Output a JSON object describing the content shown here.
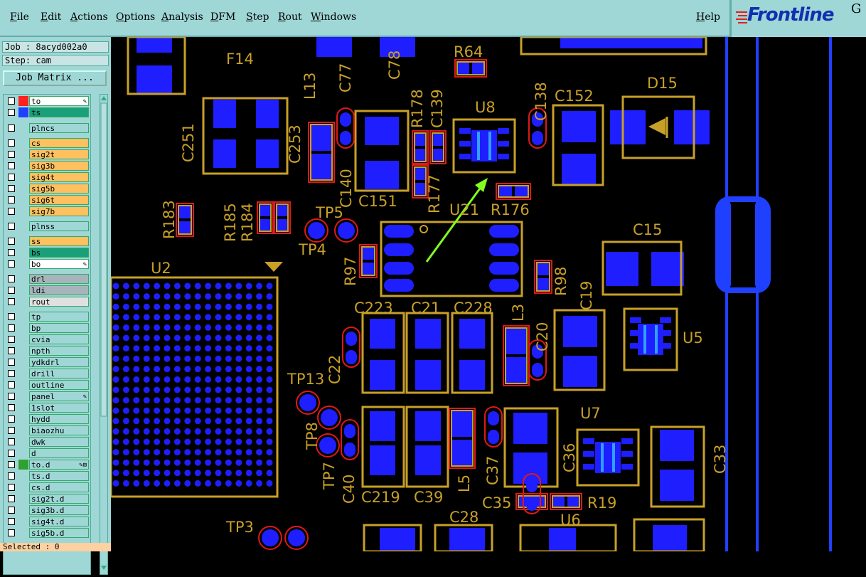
{
  "menu": {
    "items": [
      "File",
      "Edit",
      "Actions",
      "Options",
      "Analysis",
      "DFM",
      "Step",
      "Rout",
      "Windows"
    ],
    "help": "Help",
    "logo": "Frontline",
    "logo_suffix": "G"
  },
  "job": {
    "label": "Job : 8acyd002a0",
    "step": "Step: cam"
  },
  "job_matrix_button": "Job Matrix ...",
  "layers": [
    {
      "name": "to",
      "bg": "#ffffff",
      "swatch": "#ff2020",
      "icon": "✎"
    },
    {
      "name": "ts",
      "bg": "#1aa078",
      "swatch": "#2040ff",
      "icon": ""
    },
    {
      "name": "plncs",
      "bg": "#9fd6d6",
      "swatch": "",
      "icon": ""
    },
    {
      "name": "cs",
      "bg": "#ffc060",
      "swatch": "",
      "icon": ""
    },
    {
      "name": "sig2t",
      "bg": "#ffc060",
      "swatch": "",
      "icon": ""
    },
    {
      "name": "sig3b",
      "bg": "#ffc060",
      "swatch": "",
      "icon": ""
    },
    {
      "name": "sig4t",
      "bg": "#ffc060",
      "swatch": "",
      "icon": ""
    },
    {
      "name": "sig5b",
      "bg": "#ffc060",
      "swatch": "",
      "icon": ""
    },
    {
      "name": "sig6t",
      "bg": "#ffc060",
      "swatch": "",
      "icon": ""
    },
    {
      "name": "sig7b",
      "bg": "#ffc060",
      "swatch": "",
      "icon": ""
    },
    {
      "name": "plnss",
      "bg": "#9fd6d6",
      "swatch": "",
      "icon": ""
    },
    {
      "name": "ss",
      "bg": "#ffc060",
      "swatch": "",
      "icon": ""
    },
    {
      "name": "bs",
      "bg": "#1aa078",
      "swatch": "",
      "icon": ""
    },
    {
      "name": "bo",
      "bg": "#ffffff",
      "swatch": "",
      "icon": "✎"
    },
    {
      "name": "drl",
      "bg": "#a8b4bc",
      "swatch": "",
      "icon": ""
    },
    {
      "name": "ldi",
      "bg": "#a8b4bc",
      "swatch": "",
      "icon": ""
    },
    {
      "name": "rout",
      "bg": "#e0e0e0",
      "swatch": "",
      "icon": ""
    },
    {
      "name": "tp",
      "bg": "#9fd6d6",
      "swatch": "",
      "icon": ""
    },
    {
      "name": "bp",
      "bg": "#9fd6d6",
      "swatch": "",
      "icon": ""
    },
    {
      "name": "cvia",
      "bg": "#9fd6d6",
      "swatch": "",
      "icon": ""
    },
    {
      "name": "npth",
      "bg": "#9fd6d6",
      "swatch": "",
      "icon": ""
    },
    {
      "name": "ydkdrl",
      "bg": "#9fd6d6",
      "swatch": "",
      "icon": ""
    },
    {
      "name": "drill",
      "bg": "#9fd6d6",
      "swatch": "",
      "icon": ""
    },
    {
      "name": "outline",
      "bg": "#9fd6d6",
      "swatch": "",
      "icon": ""
    },
    {
      "name": "panel",
      "bg": "#9fd6d6",
      "swatch": "",
      "icon": "✎"
    },
    {
      "name": "1slot",
      "bg": "#9fd6d6",
      "swatch": "",
      "icon": ""
    },
    {
      "name": "hydd",
      "bg": "#9fd6d6",
      "swatch": "",
      "icon": ""
    },
    {
      "name": "biaozhu",
      "bg": "#9fd6d6",
      "swatch": "",
      "icon": ""
    },
    {
      "name": "dwk",
      "bg": "#9fd6d6",
      "swatch": "",
      "icon": ""
    },
    {
      "name": "d",
      "bg": "#9fd6d6",
      "swatch": "",
      "icon": ""
    },
    {
      "name": "to.d",
      "bg": "#9fd6d6",
      "swatch": "#30a030",
      "icon": "✎⊞"
    },
    {
      "name": "ts.d",
      "bg": "#9fd6d6",
      "swatch": "",
      "icon": ""
    },
    {
      "name": "cs.d",
      "bg": "#9fd6d6",
      "swatch": "",
      "icon": ""
    },
    {
      "name": "sig2t.d",
      "bg": "#9fd6d6",
      "swatch": "",
      "icon": ""
    },
    {
      "name": "sig3b.d",
      "bg": "#9fd6d6",
      "swatch": "",
      "icon": ""
    },
    {
      "name": "sig4t.d",
      "bg": "#9fd6d6",
      "swatch": "",
      "icon": ""
    },
    {
      "name": "sig5b.d",
      "bg": "#9fd6d6",
      "swatch": "",
      "icon": ""
    }
  ],
  "selected": "Selected : 0",
  "board": {
    "labels": [
      "F14",
      "L13",
      "C77",
      "C78",
      "R64",
      "U8",
      "C138",
      "C152",
      "D15",
      "C251",
      "C253",
      "C140",
      "C151",
      "R178",
      "C139",
      "R177",
      "R176",
      "R183",
      "R185",
      "R184",
      "TP5",
      "TP4",
      "U21",
      "C15",
      "R97",
      "U2",
      "R98",
      "C19",
      "C223",
      "C21",
      "C228",
      "L3",
      "C22",
      "C20",
      "U5",
      "TP13",
      "TP8",
      "TP7",
      "C40",
      "C219",
      "C39",
      "L5",
      "C37",
      "U7",
      "C36",
      "C33",
      "C35",
      "R19",
      "C28",
      "U6",
      "TP3"
    ],
    "colors": {
      "pad": "#1e1eff",
      "silk": "#c8a028",
      "mask": "#e01818",
      "arrow": "#80ff20",
      "track": "#2040ff",
      "lightpad": "#30a0ff"
    }
  }
}
